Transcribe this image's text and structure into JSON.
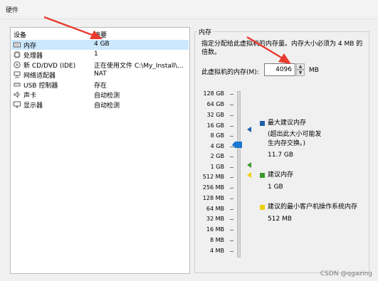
{
  "window": {
    "title": "硬件"
  },
  "device_list": {
    "columns": [
      "设备",
      "摘要"
    ],
    "rows": [
      {
        "name": "内存",
        "summary": "4 GB",
        "icon": "memory-icon",
        "selected": true
      },
      {
        "name": "处理器",
        "summary": "1",
        "icon": "processor-icon",
        "selected": false
      },
      {
        "name": "新 CD/DVD (IDE)",
        "summary": "正在使用文件 C:\\My_Install\\...",
        "icon": "cd-dvd-icon",
        "selected": false
      },
      {
        "name": "网络适配器",
        "summary": "NAT",
        "icon": "network-adapter-icon",
        "selected": false
      },
      {
        "name": "USB 控制器",
        "summary": "存在",
        "icon": "usb-controller-icon",
        "selected": false
      },
      {
        "name": "声卡",
        "summary": "自动检测",
        "icon": "sound-card-icon",
        "selected": false
      },
      {
        "name": "显示器",
        "summary": "自动检测",
        "icon": "display-icon",
        "selected": false
      }
    ]
  },
  "memory": {
    "group_title": "内存",
    "description": "指定分配给此虚拟机的内存量。内存大小必须为 4 MB 的倍数。",
    "field_label": "此虚拟机的内存(M):",
    "value": "4096",
    "unit": "MB",
    "scale": [
      "128 GB",
      "64 GB",
      "32 GB",
      "16 GB",
      "8 GB",
      "4 GB",
      "2 GB",
      "1 GB",
      "512 MB",
      "256 MB",
      "128 MB",
      "64 MB",
      "32 MB",
      "16 MB",
      "8 MB",
      "4 MB"
    ],
    "max_recommended": {
      "label": "最大建议内存",
      "note": "(超出此大小可能发生内存交换。)",
      "value": "11.7 GB",
      "color": "#1f5fa8"
    },
    "recommended": {
      "label": "建议内存",
      "value": "1 GB",
      "color": "#3a9b2c"
    },
    "guest_min": {
      "label": "建议的最小客户机操作系统内存",
      "value": "512 MB",
      "color": "#f0d000"
    }
  },
  "watermark": "CSDN @qgazing",
  "colors": {
    "selection": "#cce8ff",
    "slider_thumb": "#1b78d0",
    "annotation_arrow": "#e83b2e"
  }
}
